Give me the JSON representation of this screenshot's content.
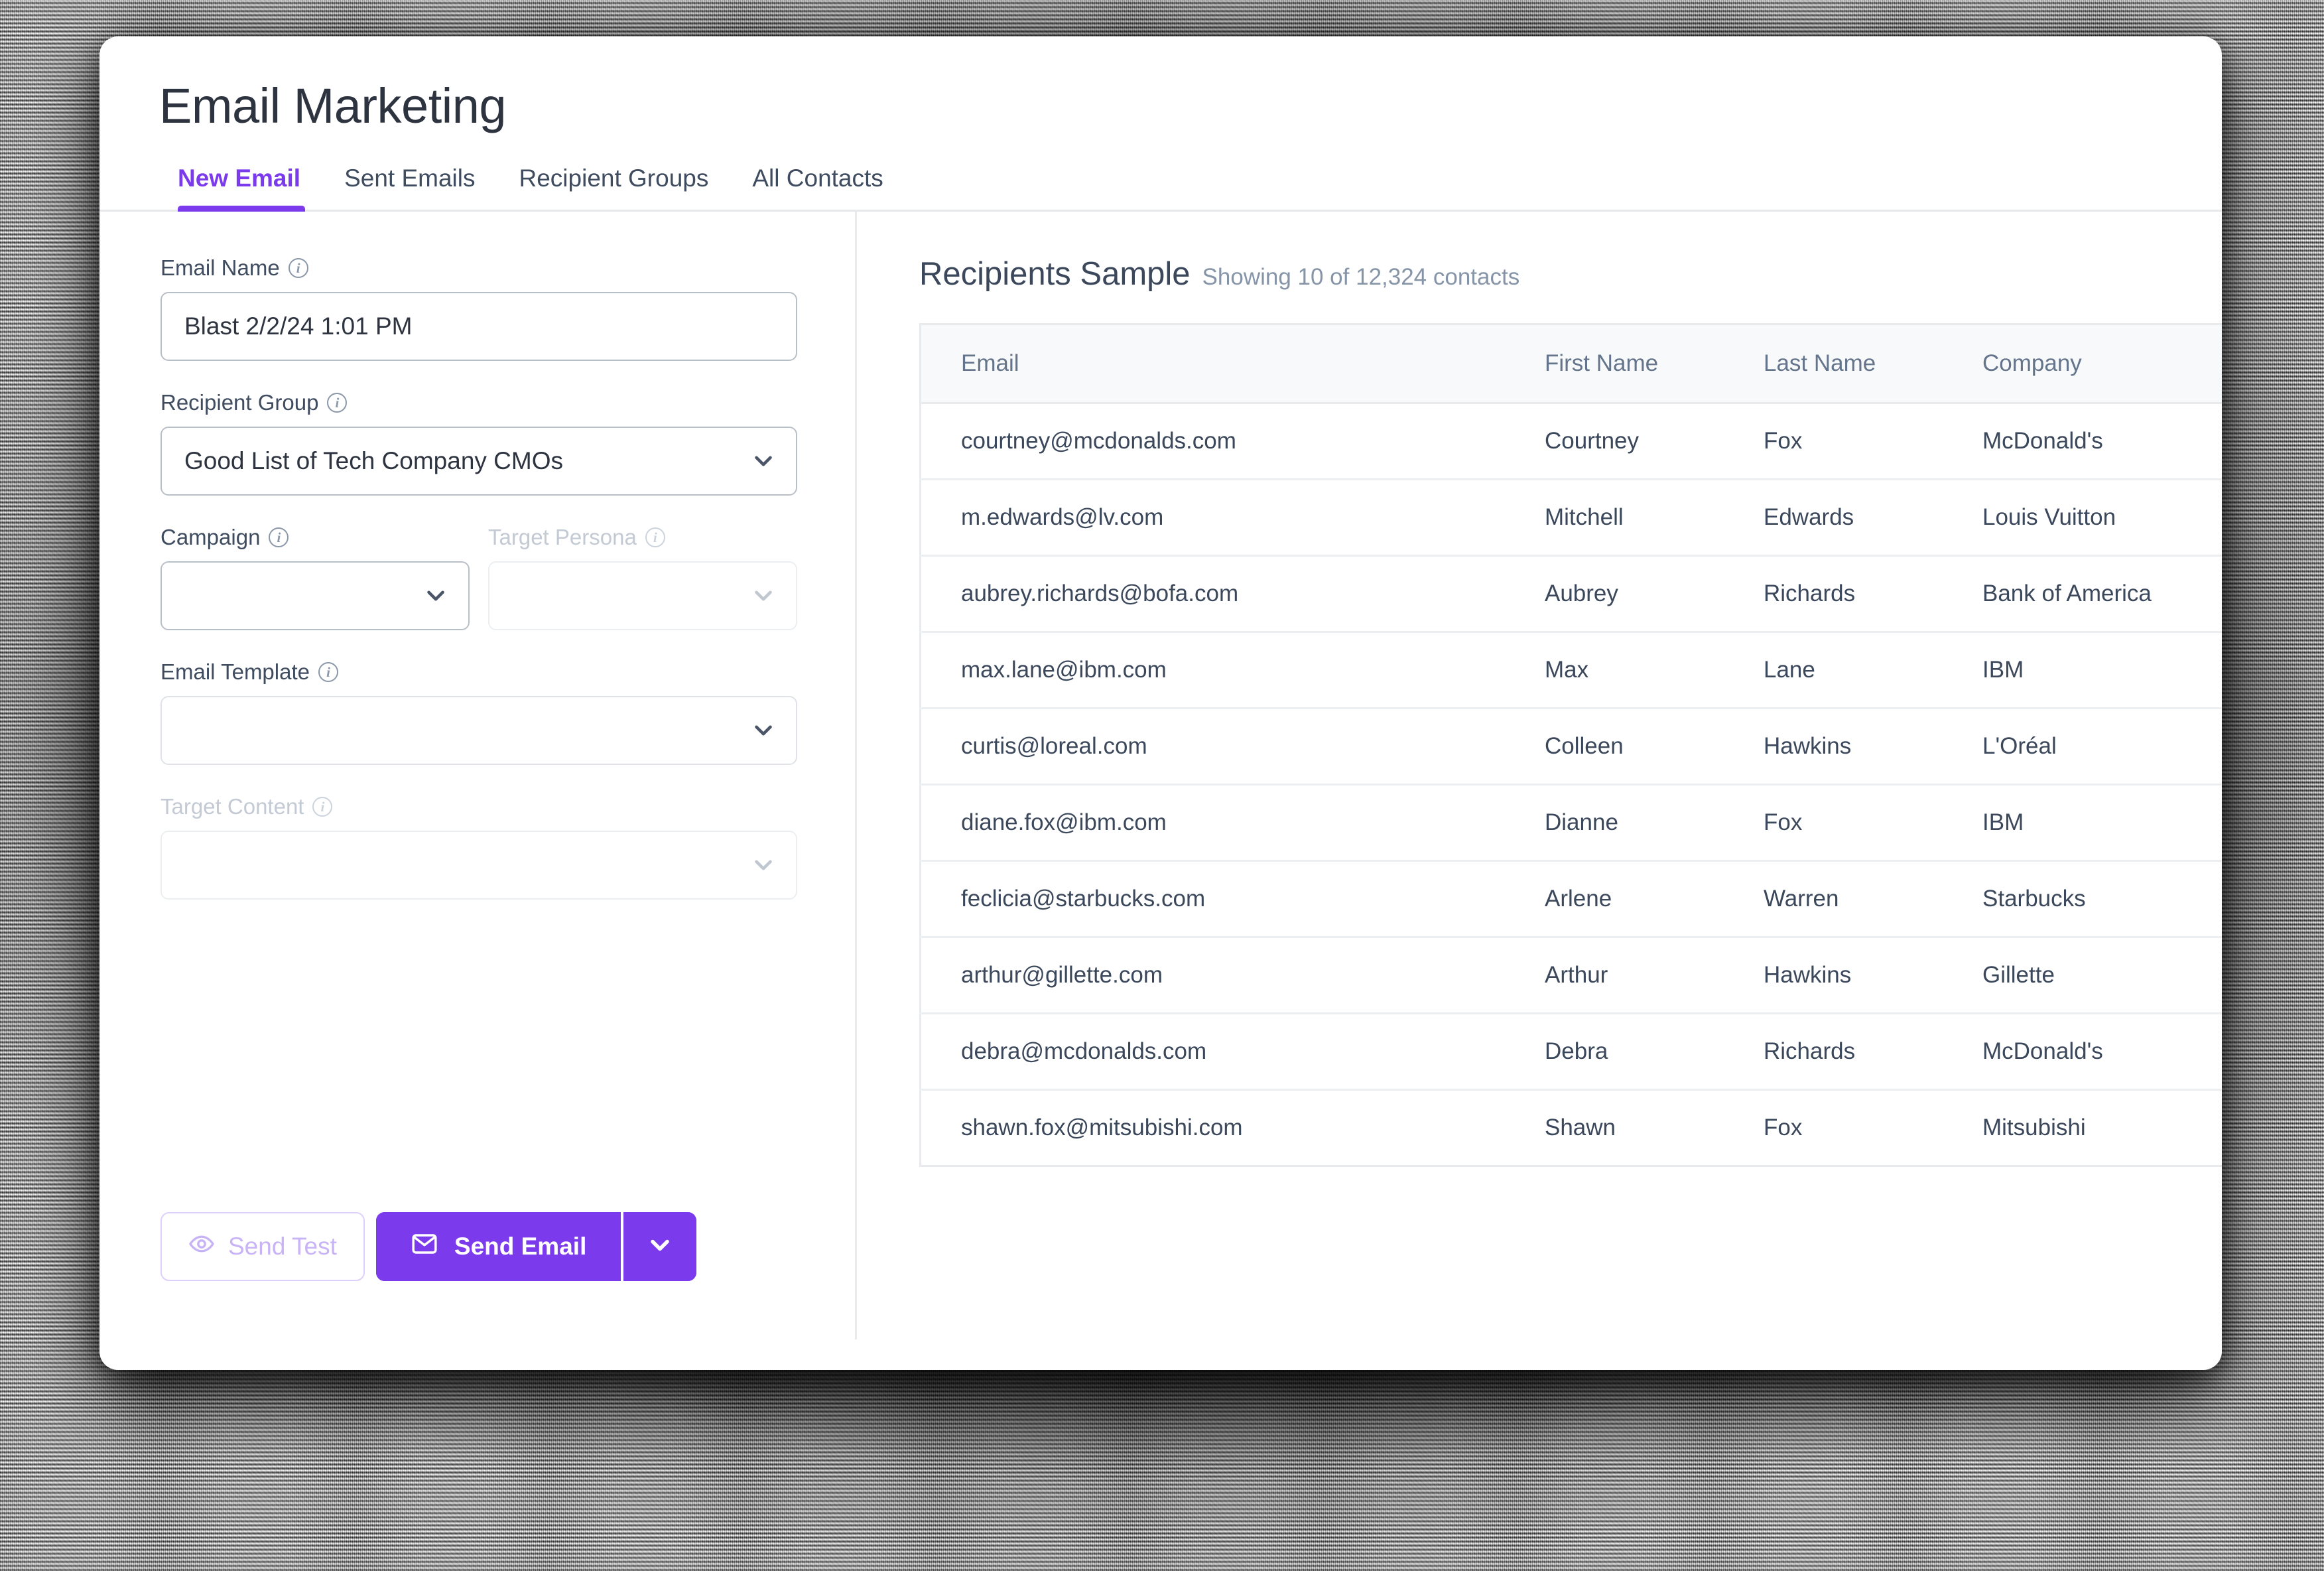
{
  "app": {
    "title": "Email Marketing",
    "accent_color": "#7C3AED",
    "text_color": "#3B475A"
  },
  "tabs": [
    {
      "label": "New Email",
      "active": true
    },
    {
      "label": "Sent Emails",
      "active": false
    },
    {
      "label": "Recipient Groups",
      "active": false
    },
    {
      "label": "All Contacts",
      "active": false
    }
  ],
  "form": {
    "email_name": {
      "label": "Email Name",
      "value": "Blast 2/2/24 1:01 PM",
      "placeholder": ""
    },
    "recipient_group": {
      "label": "Recipient Group",
      "value": "Good List of Tech Company CMOs",
      "placeholder": ""
    },
    "campaign": {
      "label": "Campaign",
      "value": "",
      "placeholder": ""
    },
    "target_persona": {
      "label": "Target Persona",
      "value": "",
      "placeholder": "",
      "disabled": true
    },
    "email_template": {
      "label": "Email Template",
      "value": "",
      "placeholder": ""
    },
    "target_content": {
      "label": "Target Content",
      "value": "",
      "placeholder": "",
      "disabled": true
    }
  },
  "actions": {
    "send_test_label": "Send Test",
    "send_email_label": "Send Email"
  },
  "recipients_panel": {
    "title": "Recipients Sample",
    "subtitle": "Showing 10 of 12,324 contacts",
    "columns": [
      "Email",
      "First Name",
      "Last Name",
      "Company"
    ],
    "rows": [
      {
        "email": "courtney@mcdonalds.com",
        "first": "Courtney",
        "last": "Fox",
        "company": "McDonald's"
      },
      {
        "email": "m.edwards@lv.com",
        "first": "Mitchell",
        "last": "Edwards",
        "company": "Louis Vuitton"
      },
      {
        "email": "aubrey.richards@bofa.com",
        "first": "Aubrey",
        "last": "Richards",
        "company": "Bank of America"
      },
      {
        "email": "max.lane@ibm.com",
        "first": "Max",
        "last": "Lane",
        "company": "IBM"
      },
      {
        "email": "curtis@loreal.com",
        "first": "Colleen",
        "last": "Hawkins",
        "company": "L'Oréal"
      },
      {
        "email": "diane.fox@ibm.com",
        "first": "Dianne",
        "last": "Fox",
        "company": "IBM"
      },
      {
        "email": "feclicia@starbucks.com",
        "first": "Arlene",
        "last": "Warren",
        "company": "Starbucks"
      },
      {
        "email": "arthur@gillette.com",
        "first": "Arthur",
        "last": "Hawkins",
        "company": "Gillette"
      },
      {
        "email": "debra@mcdonalds.com",
        "first": "Debra",
        "last": "Richards",
        "company": "McDonald's"
      },
      {
        "email": "shawn.fox@mitsubishi.com",
        "first": "Shawn",
        "last": "Fox",
        "company": "Mitsubishi"
      }
    ]
  },
  "icons": {
    "info": "info-icon",
    "chevron_down": "chevron-down-icon",
    "envelope": "envelope-icon",
    "eye": "eye-icon"
  }
}
